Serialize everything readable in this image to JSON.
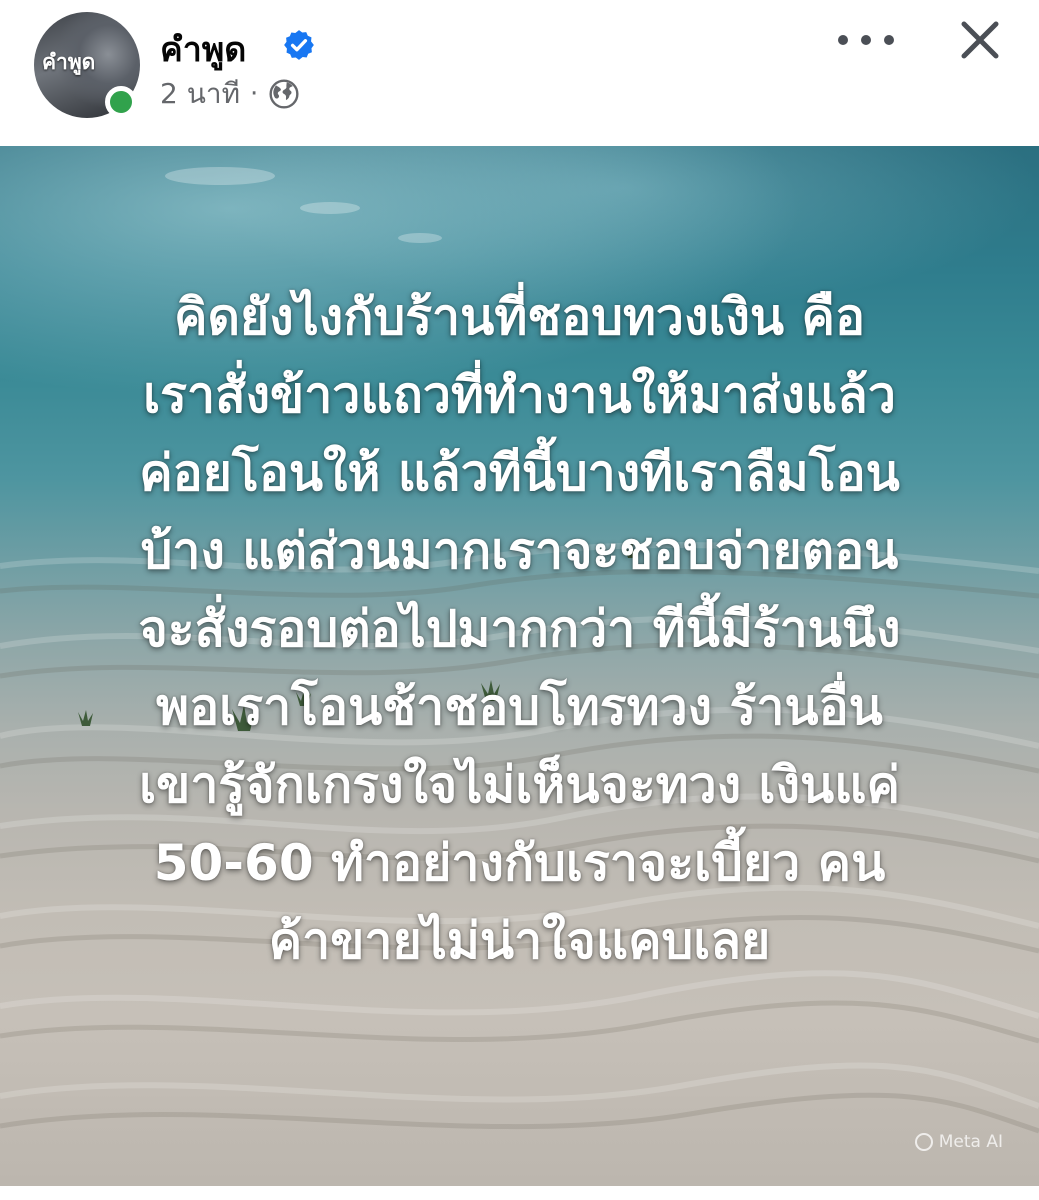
{
  "post": {
    "avatar_text": "คำพูด",
    "page_name": "คำพูด",
    "verified": true,
    "timestamp": "2 นาที",
    "separator": "·",
    "privacy_icon": "globe-icon",
    "online_status_color": "#31a24c",
    "verified_color": "#1877f2"
  },
  "actions": {
    "more_icon": "more-horizontal-icon",
    "close_icon": "close-icon"
  },
  "image": {
    "quote_lines": [
      "คิดยังไงกับร้านที่ชอบทวงเงิน คือ",
      "เราสั่งข้าวแถวที่ทำงานให้มาส่งแล้ว",
      "ค่อยโอนให้ แล้วทีนี้บางทีเราลืมโอน",
      "บ้าง แต่ส่วนมากเราจะชอบจ่ายตอน",
      "จะสั่งรอบต่อไปมากกว่า ทีนี้มีร้านนึง",
      "พอเราโอนช้าชอบโทรทวง ร้านอื่น",
      "เขารู้จักเกรงใจไม่เห็นจะทวง เงินแค่",
      "50-60 ทำอย่างกับเราจะเบี้ยว คน",
      "ค้าขายไม่น่าใจแคบเลย"
    ],
    "watermark": "Meta AI"
  }
}
